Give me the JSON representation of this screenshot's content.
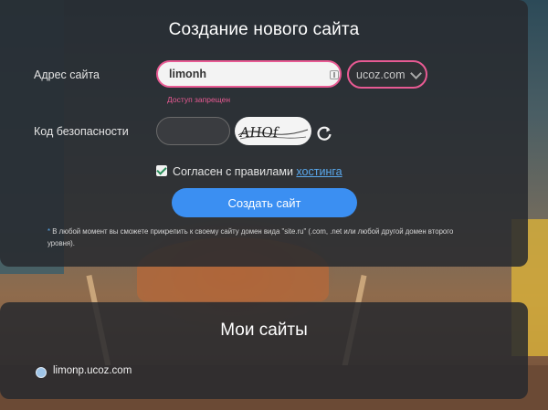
{
  "form": {
    "title": "Создание нового сайта",
    "address_label": "Адрес сайта",
    "address_value": "limonh",
    "domain_selected": "ucoz.com",
    "error_text": "Доступ запрещен",
    "security_label": "Код безопасности",
    "security_value": "",
    "captcha_text": "AHOf",
    "agree_text": "Согласен с правилами",
    "agree_link": "хостинга",
    "agree_checked": true,
    "submit_label": "Создать сайт",
    "note_star": "*",
    "note_text": "В любой момент вы сможете прикрепить к своему сайту домен вида \"site.ru\" (.com, .net или любой другой домен второго уровня)."
  },
  "my_sites": {
    "title": "Мои сайты",
    "items": [
      "limonp.ucoz.com"
    ]
  },
  "colors": {
    "accent_pink": "#e85a93",
    "button_blue": "#3b8ff2",
    "link_blue": "#5aa9ee",
    "panel_bg": "#2a2c30"
  }
}
